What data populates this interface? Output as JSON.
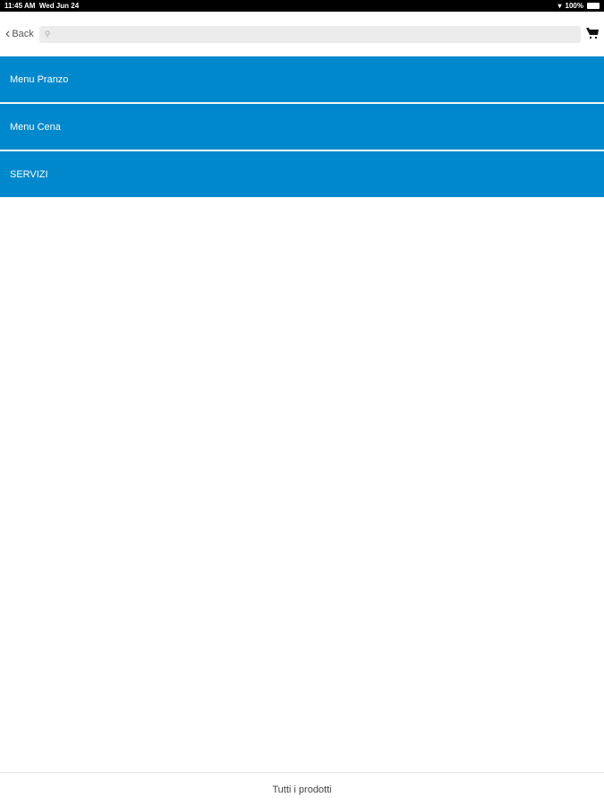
{
  "status": {
    "time": "11:45 AM",
    "date": "Wed Jun 24",
    "battery": "100%"
  },
  "nav": {
    "back_label": "Back",
    "search_placeholder": ""
  },
  "menu": [
    {
      "label": "Menu Pranzo"
    },
    {
      "label": "Menu Cena"
    },
    {
      "label": "SERVIZI"
    }
  ],
  "footer": {
    "label": "Tutti i prodotti"
  }
}
